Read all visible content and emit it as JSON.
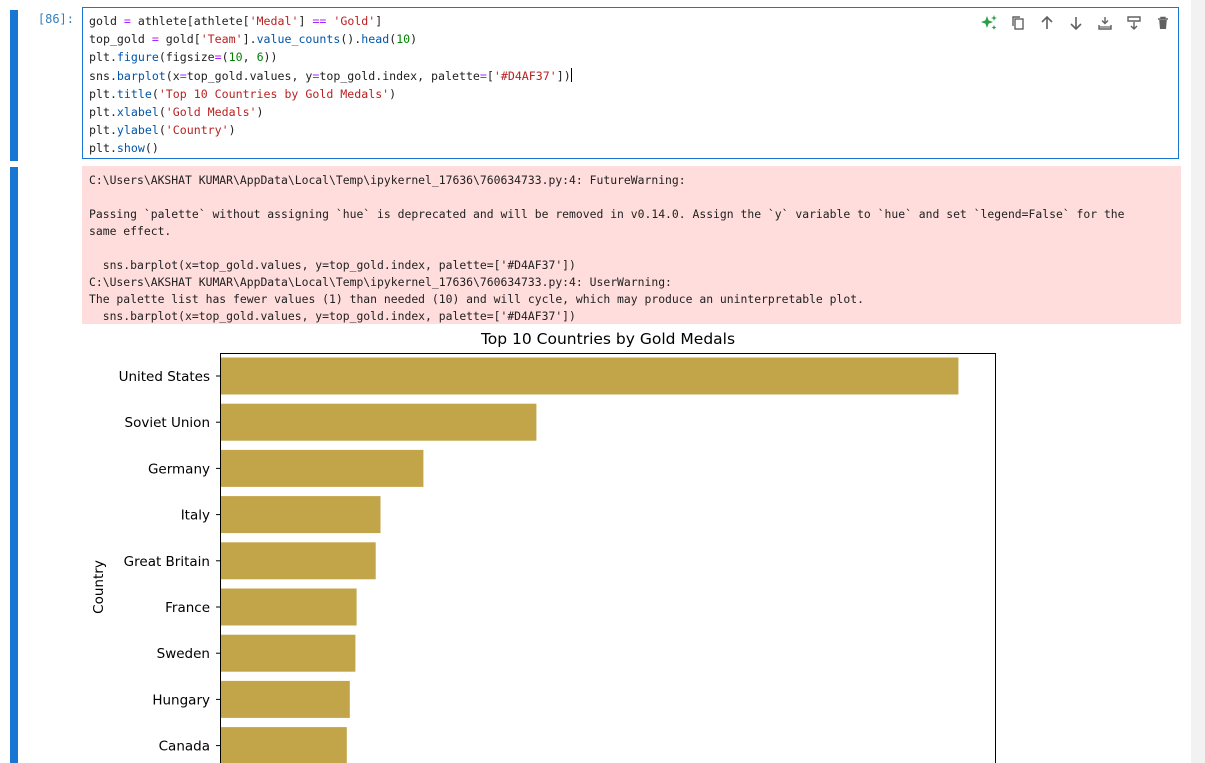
{
  "cell": {
    "prompt": "[86]:",
    "code_lines": [
      [
        {
          "t": "gold "
        },
        {
          "t": "=",
          "c": "op"
        },
        {
          "t": " athlete[athlete["
        },
        {
          "t": "'Medal'",
          "c": "str"
        },
        {
          "t": "] "
        },
        {
          "t": "==",
          "c": "op"
        },
        {
          "t": " "
        },
        {
          "t": "'Gold'",
          "c": "str"
        },
        {
          "t": "]"
        }
      ],
      [
        {
          "t": "top_gold "
        },
        {
          "t": "=",
          "c": "op"
        },
        {
          "t": " gold["
        },
        {
          "t": "'Team'",
          "c": "str"
        },
        {
          "t": "]."
        },
        {
          "t": "value_counts",
          "c": "fn"
        },
        {
          "t": "()."
        },
        {
          "t": "head",
          "c": "fn"
        },
        {
          "t": "("
        },
        {
          "t": "10",
          "c": "num"
        },
        {
          "t": ")"
        }
      ],
      [
        {
          "t": "plt."
        },
        {
          "t": "figure",
          "c": "fn"
        },
        {
          "t": "(figsize"
        },
        {
          "t": "=",
          "c": "op"
        },
        {
          "t": "("
        },
        {
          "t": "10",
          "c": "num"
        },
        {
          "t": ", "
        },
        {
          "t": "6",
          "c": "num"
        },
        {
          "t": "))"
        }
      ],
      [
        {
          "t": "sns."
        },
        {
          "t": "barplot",
          "c": "fn"
        },
        {
          "t": "(x"
        },
        {
          "t": "=",
          "c": "op"
        },
        {
          "t": "top_gold.values, y"
        },
        {
          "t": "=",
          "c": "op"
        },
        {
          "t": "top_gold.index, palette"
        },
        {
          "t": "=",
          "c": "op"
        },
        {
          "t": "["
        },
        {
          "t": "'#D4AF37'",
          "c": "str"
        },
        {
          "t": "])"
        }
      ],
      [
        {
          "t": "plt."
        },
        {
          "t": "title",
          "c": "fn"
        },
        {
          "t": "("
        },
        {
          "t": "'Top 10 Countries by Gold Medals'",
          "c": "str"
        },
        {
          "t": ")"
        }
      ],
      [
        {
          "t": "plt."
        },
        {
          "t": "xlabel",
          "c": "fn"
        },
        {
          "t": "("
        },
        {
          "t": "'Gold Medals'",
          "c": "str"
        },
        {
          "t": ")"
        }
      ],
      [
        {
          "t": "plt."
        },
        {
          "t": "ylabel",
          "c": "fn"
        },
        {
          "t": "("
        },
        {
          "t": "'Country'",
          "c": "str"
        },
        {
          "t": ")"
        }
      ],
      [
        {
          "t": "plt."
        },
        {
          "t": "show",
          "c": "fn"
        },
        {
          "t": "()"
        }
      ]
    ],
    "toolbar": [
      {
        "name": "ai-assist-icon",
        "icon": "sparkles-icon",
        "color": "#2e9e44"
      },
      {
        "name": "duplicate-cell-icon",
        "icon": "copy-icon",
        "color": "#616161"
      },
      {
        "name": "move-up-icon",
        "icon": "arrow-up-icon",
        "color": "#616161"
      },
      {
        "name": "move-down-icon",
        "icon": "arrow-down-icon",
        "color": "#616161"
      },
      {
        "name": "insert-above-icon",
        "icon": "insert-above-icon",
        "color": "#616161"
      },
      {
        "name": "insert-below-icon",
        "icon": "insert-below-icon",
        "color": "#616161"
      },
      {
        "name": "delete-cell-icon",
        "icon": "trash-icon",
        "color": "#616161"
      }
    ]
  },
  "output": {
    "stderr": "C:\\Users\\AKSHAT KUMAR\\AppData\\Local\\Temp\\ipykernel_17636\\760634733.py:4: FutureWarning:\n\nPassing `palette` without assigning `hue` is deprecated and will be removed in v0.14.0. Assign the `y` variable to `hue` and set `legend=False` for the\nsame effect.\n\n  sns.barplot(x=top_gold.values, y=top_gold.index, palette=['#D4AF37'])\nC:\\Users\\AKSHAT KUMAR\\AppData\\Local\\Temp\\ipykernel_17636\\760634733.py:4: UserWarning:\nThe palette list has fewer values (1) than needed (10) and will cycle, which may produce an uninterpretable plot.\n  sns.barplot(x=top_gold.values, y=top_gold.index, palette=['#D4AF37'])"
  },
  "colors": {
    "bar": "#c2a548",
    "cell_active": "#1976d2",
    "stderr_bg": "#ffdddd"
  },
  "chart_data": {
    "type": "bar",
    "orientation": "horizontal",
    "title": "Top 10 Countries by Gold Medals",
    "ylabel": "Country",
    "categories": [
      "United States",
      "Soviet Union",
      "Germany",
      "Italy",
      "Great Britain",
      "France",
      "Sweden",
      "Hungary",
      "Canada"
    ],
    "values": [
      2474,
      1058,
      679,
      535,
      519,
      455,
      451,
      432,
      422
    ],
    "xlim": [
      0,
      2600
    ]
  }
}
